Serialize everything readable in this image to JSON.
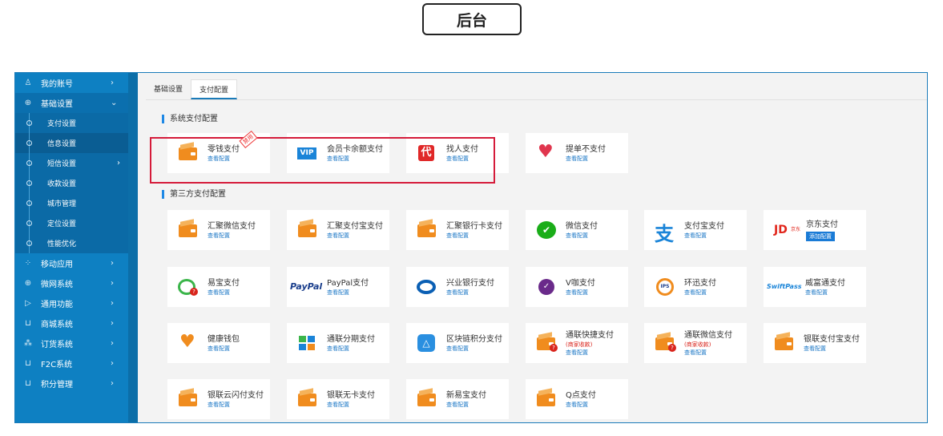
{
  "page": {
    "title": "后台"
  },
  "sidebar": {
    "items": [
      {
        "label": "我的账号",
        "icon": "user-icon"
      },
      {
        "label": "基础设置",
        "icon": "globe-icon"
      },
      {
        "label": "移动应用",
        "icon": "apps-icon"
      },
      {
        "label": "微网系统",
        "icon": "globe-icon"
      },
      {
        "label": "通用功能",
        "icon": "play-icon"
      },
      {
        "label": "商城系统",
        "icon": "cart-icon"
      },
      {
        "label": "订货系统",
        "icon": "org-icon"
      },
      {
        "label": "F2C系统",
        "icon": "cart-icon"
      },
      {
        "label": "积分管理",
        "icon": "cart-icon"
      }
    ],
    "sub_items": [
      "支付设置",
      "信息设置",
      "短信设置",
      "收款设置",
      "城市管理",
      "定位设置",
      "性能优化"
    ]
  },
  "tabs": [
    "基础设置",
    "支付配置"
  ],
  "sections": {
    "system": "系统支付配置",
    "third": "第三方支付配置"
  },
  "labels": {
    "view_config": "查看配置",
    "add_config": "添加配置",
    "merchant_note": "(商家收款)",
    "tag": "禁用"
  },
  "cards": {
    "c1": "零钱支付",
    "c2": "会员卡余额支付",
    "c3": "找人支付",
    "c4": "提单不支付",
    "c5": "汇聚微信支付",
    "c6": "汇聚支付宝支付",
    "c7": "汇聚银行卡支付",
    "c8": "微信支付",
    "c9": "支付宝支付",
    "c10": "京东支付",
    "c11": "易宝支付",
    "c12": "PayPal支付",
    "c13": "兴业银行支付",
    "c14": "V咖支付",
    "c15": "环迅支付",
    "c16": "威富通支付",
    "c17": "健康钱包",
    "c18": "通联分期支付",
    "c19": "区块链积分支付",
    "c20": "通联快捷支付",
    "c21": "通联微信支付",
    "c22": "银联支付宝支付",
    "c23": "银联云闪付支付",
    "c24": "银联无卡支付",
    "c25": "新易宝支付",
    "c26": "Q点支付"
  },
  "logos": {
    "vip": "VIP",
    "dai": "代",
    "paypal": "PayPal",
    "jd": "JD",
    "jd_small": "京东",
    "swift": "SwiftPass",
    "ips": "IPS"
  },
  "colors": {
    "sidebar": "#0e80c2",
    "accent": "#1a7bb9",
    "wallet": "#f08c1e",
    "highlight": "#d51b3a"
  }
}
